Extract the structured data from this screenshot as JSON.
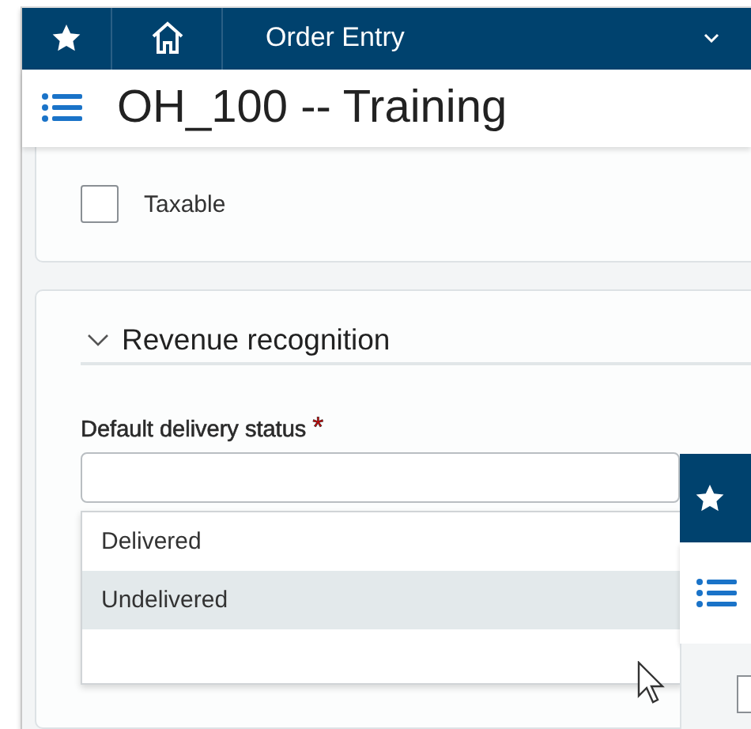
{
  "header": {
    "module": "Order Entry"
  },
  "page_title": "OH_100 -- Training",
  "taxable": {
    "label": "Taxable",
    "checked": false
  },
  "section": {
    "title": "Revenue recognition",
    "expanded": true
  },
  "delivery_field": {
    "label": "Default delivery status",
    "required": true,
    "required_mark": "*",
    "open": true,
    "options": [
      {
        "label": "Delivered",
        "selected": false
      },
      {
        "label": "Undelivered",
        "selected": true
      }
    ]
  },
  "overlay_window": {
    "checkbox_checked": false
  }
}
